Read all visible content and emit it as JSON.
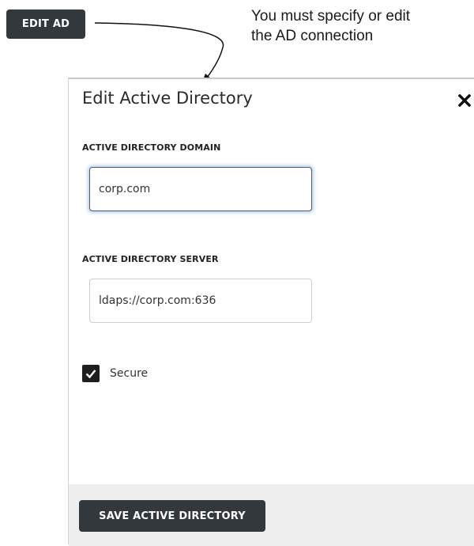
{
  "top_button": {
    "label": "EDIT AD"
  },
  "annotation": {
    "line1": "You must specify or edit",
    "line2": "the AD connection"
  },
  "dialog": {
    "title": "Edit Active Directory",
    "close_icon": "close-icon",
    "domain_field": {
      "label": "ACTIVE DIRECTORY DOMAIN",
      "value": "corp.com"
    },
    "server_field": {
      "label": "ACTIVE DIRECTORY SERVER",
      "value": "ldaps://corp.com:636"
    },
    "secure_checkbox": {
      "label": "Secure",
      "checked": true
    },
    "save_button": {
      "label": "SAVE ACTIVE DIRECTORY"
    }
  },
  "colors": {
    "button_bg": "#33383c",
    "footer_bg": "#eeeeee",
    "focus_glow": "#78aae6"
  }
}
